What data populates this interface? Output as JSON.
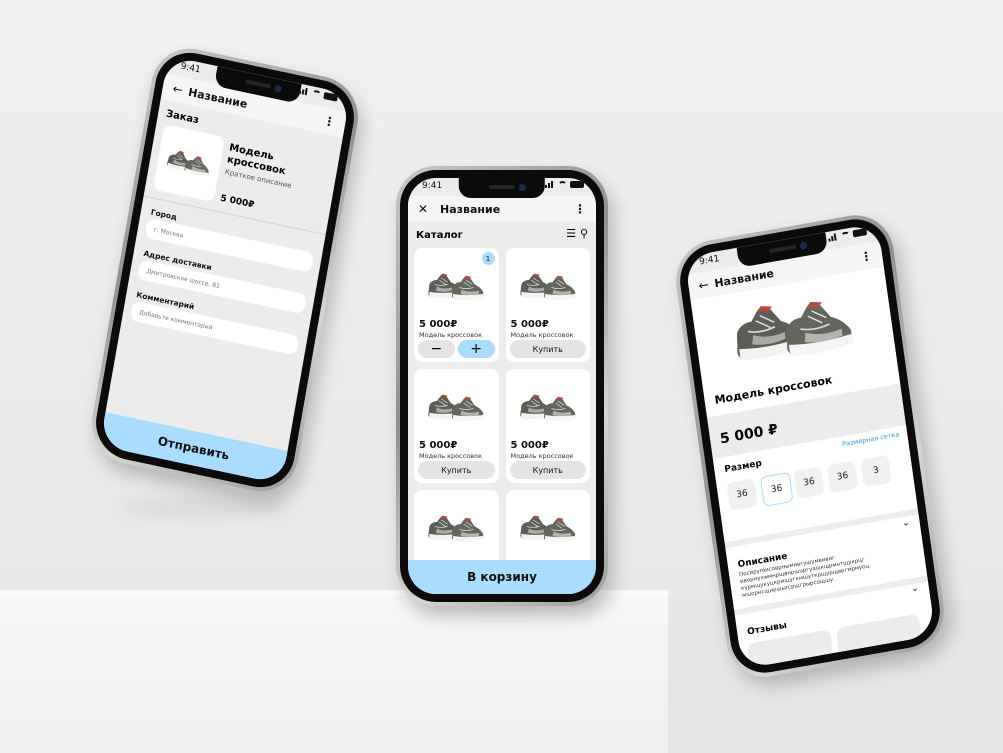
{
  "status_time": "9:41",
  "left_phone": {
    "header_title": "Название",
    "section_title": "Заказ",
    "product_name": "Модель кроссовок",
    "product_desc": "Краткое описание",
    "product_price": "5 000₽",
    "city_label": "Город",
    "city_value": "г. Москва",
    "address_label": "Адрес доставки",
    "address_value": "Дмитровское шоссе, 81",
    "comment_label": "Комментарий",
    "comment_placeholder": "Добавьте комментарий",
    "submit_label": "Отправить"
  },
  "center_phone": {
    "header_title": "Название",
    "section_title": "Каталог",
    "cart_button": "В корзину",
    "buy_label": "Купить",
    "badge_count": "1",
    "minus": "−",
    "plus": "+",
    "tiles": [
      {
        "price": "5 000₽",
        "name": "Модель кроссовок"
      },
      {
        "price": "5 000₽",
        "name": "Модель кроссовок"
      },
      {
        "price": "5 000₽",
        "name": "Модель кроссовок"
      },
      {
        "price": "5 000₽",
        "name": "Модель кроссовок"
      }
    ]
  },
  "right_phone": {
    "header_title": "Название",
    "product_name": "Модель кроссовок",
    "price": "5 000 ₽",
    "size_label": "Размер",
    "size_chart_link": "Размерная сетка",
    "sizes": [
      "36",
      "36",
      "36",
      "36",
      "3"
    ],
    "description_label": "Описание",
    "description_text": "Посируroисоврнымивгушумвивиг иворнуxwмнрщвнршupгуашкщрмнтщукрцг курмщукуцкрмщугкмшyткрщyрщвргмрмуоц мшорнсщиршыrсрщгрырсощшу.",
    "reviews_label": "Отзывы"
  },
  "colors": {
    "accent": "#a9dcff",
    "screen_bg": "#ececec",
    "card_bg": "#ffffff",
    "button_gray": "#e4e4e4"
  }
}
